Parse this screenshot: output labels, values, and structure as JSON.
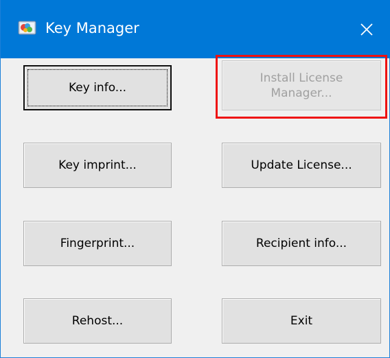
{
  "window": {
    "title": "Key Manager",
    "app_icon": "key-manager-app-icon",
    "close_icon": "close-icon"
  },
  "buttons": {
    "key_info": "Key info...",
    "install_license_manager": "Install License\nManager...",
    "key_imprint": "Key imprint...",
    "update_license": "Update License...",
    "fingerprint": "Fingerprint...",
    "recipient_info": "Recipient info...",
    "rehost": "Rehost...",
    "exit": "Exit"
  },
  "states": {
    "install_license_manager_enabled": false,
    "default_button": "key_info"
  },
  "colors": {
    "titlebar": "#0078d7",
    "highlight": "#ee1111",
    "disabled_text": "#a0a0a0"
  }
}
